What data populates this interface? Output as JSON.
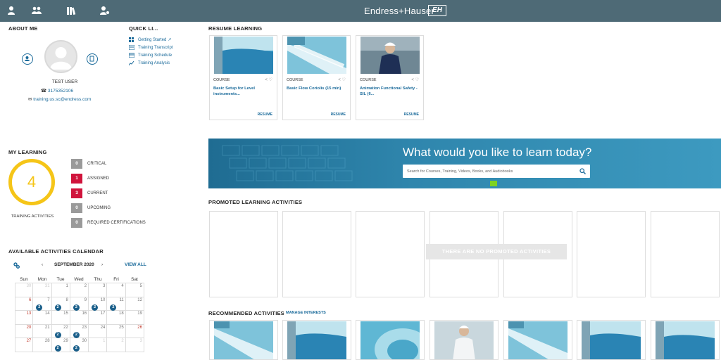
{
  "nav": {
    "icons": [
      "user-icon",
      "group-icon",
      "library-icon",
      "team-settings-icon"
    ],
    "brand": "Endress+Hauser",
    "brand_logo": "EH"
  },
  "about": {
    "title": "ABOUT ME",
    "name": "TEST USER",
    "phone": "3175352106",
    "email": "training.us.sc@endress.com"
  },
  "quick_links": {
    "title": "QUICK LI...",
    "items": [
      {
        "label": "Getting Started",
        "icon": "grid-icon"
      },
      {
        "label": "Training Transcript",
        "icon": "transcript-icon"
      },
      {
        "label": "Training Schedule",
        "icon": "calendar-icon"
      },
      {
        "label": "Training Analysis",
        "icon": "chart-icon"
      }
    ]
  },
  "my_learning": {
    "title": "MY LEARNING",
    "count": "4",
    "count_label": "TRAINING ACTIVITIES",
    "statuses": [
      {
        "value": "0",
        "label": "CRITICAL",
        "color": "#9a9a9a"
      },
      {
        "value": "1",
        "label": "ASSIGNED",
        "color": "#d0143c"
      },
      {
        "value": "3",
        "label": "CURRENT",
        "color": "#d0143c"
      },
      {
        "value": "0",
        "label": "UPCOMING",
        "color": "#9a9a9a"
      },
      {
        "value": "0",
        "label": "REQUIRED CERTIFICATIONS",
        "color": "#9a9a9a"
      }
    ]
  },
  "calendar": {
    "title": "AVAILABLE ACTIVITIES CALENDAR",
    "month": "SEPTEMBER 2020",
    "view_all": "VIEW ALL",
    "days": [
      "Sun",
      "Mon",
      "Tue",
      "Wed",
      "Thu",
      "Fri",
      "Sat"
    ],
    "weeks": [
      [
        {
          "d": "30",
          "dim": true
        },
        {
          "d": "31",
          "dim": true
        },
        {
          "d": "1"
        },
        {
          "d": "2"
        },
        {
          "d": "3"
        },
        {
          "d": "4"
        },
        {
          "d": "5"
        }
      ],
      [
        {
          "d": "6",
          "red": true
        },
        {
          "d": "7",
          "count": "2"
        },
        {
          "d": "8",
          "count": "2"
        },
        {
          "d": "9",
          "count": "2"
        },
        {
          "d": "10",
          "count": "2"
        },
        {
          "d": "11",
          "count": "2"
        },
        {
          "d": "12"
        }
      ],
      [
        {
          "d": "13",
          "red": true
        },
        {
          "d": "14"
        },
        {
          "d": "15"
        },
        {
          "d": "16"
        },
        {
          "d": "17"
        },
        {
          "d": "18"
        },
        {
          "d": "19"
        }
      ],
      [
        {
          "d": "20",
          "red": true
        },
        {
          "d": "21"
        },
        {
          "d": "22",
          "count": "2"
        },
        {
          "d": "23",
          "count": "2"
        },
        {
          "d": "24"
        },
        {
          "d": "25"
        },
        {
          "d": "26",
          "red": true
        }
      ],
      [
        {
          "d": "27",
          "red": true
        },
        {
          "d": "28"
        },
        {
          "d": "29",
          "count": "2"
        },
        {
          "d": "30",
          "count": "2"
        },
        {
          "d": "1",
          "dim": true
        },
        {
          "d": "2",
          "dim": true
        },
        {
          "d": "3",
          "dim": true
        }
      ]
    ]
  },
  "resume": {
    "title": "RESUME LEARNING",
    "cards": [
      {
        "type": "COURSE",
        "title": "Basic Setup for Level instruments...",
        "action": "RESUME"
      },
      {
        "type": "COURSE",
        "title": "Basic Flow Coriolis (15 min)",
        "action": "RESUME"
      },
      {
        "type": "COURSE",
        "title": "Animation Functional Safety - SIL (6...",
        "action": "RESUME"
      }
    ]
  },
  "banner": {
    "title": "What would you like to learn today?",
    "search_placeholder": "Search for Courses, Training, Videos, Books, and Audiobooks"
  },
  "promoted": {
    "title": "PROMOTED LEARNING ACTIVITIES",
    "empty_message": "THERE ARE NO PROMOTED ACTIVITIES"
  },
  "recommended": {
    "title": "RECOMMENDED ACTIVITIES",
    "manage": "MANAGE INTERESTS"
  }
}
